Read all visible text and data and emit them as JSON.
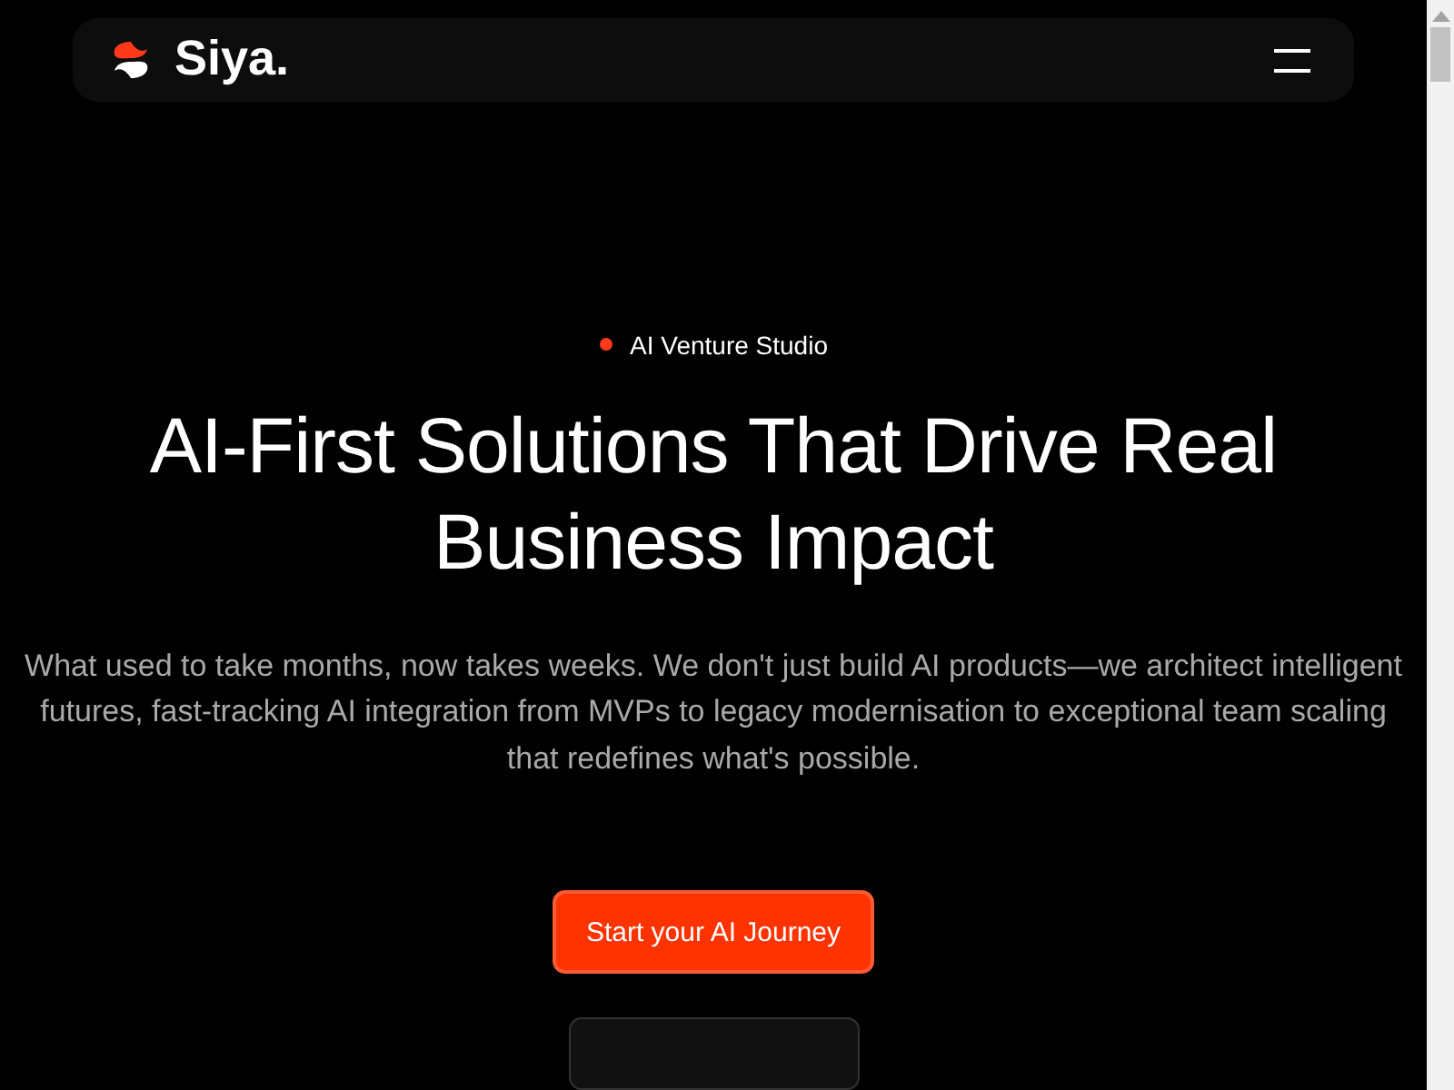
{
  "header": {
    "brand": "Siya."
  },
  "hero": {
    "badge": "AI Venture Studio",
    "title": "AI-First Solutions That Drive Real Business Impact",
    "description": "What used to take months, now takes weeks. We don't just build AI products—we architect intelligent futures, fast-tracking AI integration from MVPs to legacy modernisation to exceptional team scaling that redefines what's possible.",
    "buttons": [
      {
        "label": "Start your AI Journey",
        "kind": "primary"
      },
      {
        "kind": "secondary"
      }
    ]
  }
}
